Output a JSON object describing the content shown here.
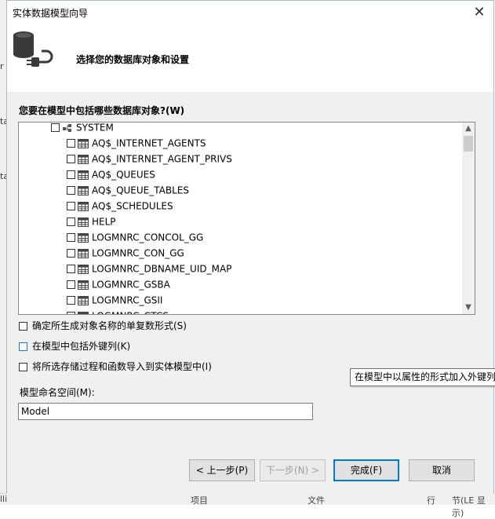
{
  "background": {
    "left_fragments": [
      "r",
      "ta",
      "ta"
    ],
    "bottom_fragments": [
      "lli",
      "项目",
      "文件",
      "行",
      "节(LE 显示)"
    ]
  },
  "dialog": {
    "title": "实体数据模型向导",
    "close_glyph": "✕",
    "header": {
      "heading": "选择您的数据库对象和设置"
    },
    "objects_label": "您要在模型中包括哪些数据库对象?(W)",
    "tree": {
      "schema": {
        "name": "SYSTEM",
        "checked": false
      },
      "tables": [
        "AQ$_INTERNET_AGENTS",
        "AQ$_INTERNET_AGENT_PRIVS",
        "AQ$_QUEUES",
        "AQ$_QUEUE_TABLES",
        "AQ$_SCHEDULES",
        "HELP",
        "LOGMNRC_CONCOL_GG",
        "LOGMNRC_CON_GG",
        "LOGMNRC_DBNAME_UID_MAP",
        "LOGMNRC_GSBA",
        "LOGMNRC_GSII",
        "LOGMNRC_GTCS"
      ],
      "scroll_up_glyph": "▲",
      "scroll_down_glyph": "▼"
    },
    "options": {
      "pluralize": "确定所生成对象名称的单复数形式(S)",
      "foreign_keys": "在模型中包括外键列(K)",
      "import_procs": "将所选存储过程和函数导入到实体模型中(I)"
    },
    "tooltip": "在模型中以属性的形式加入外键列",
    "namespace": {
      "label": "模型命名空间(M):",
      "value": "Model"
    },
    "buttons": {
      "prev": "< 上一步(P)",
      "next": "下一步(N) >",
      "finish": "完成(F)",
      "cancel": "取消"
    }
  },
  "colors": {
    "accent": "#0078d7",
    "content_bg": "#f0f0f0",
    "checkbox_focus": "#1a7bd1"
  }
}
